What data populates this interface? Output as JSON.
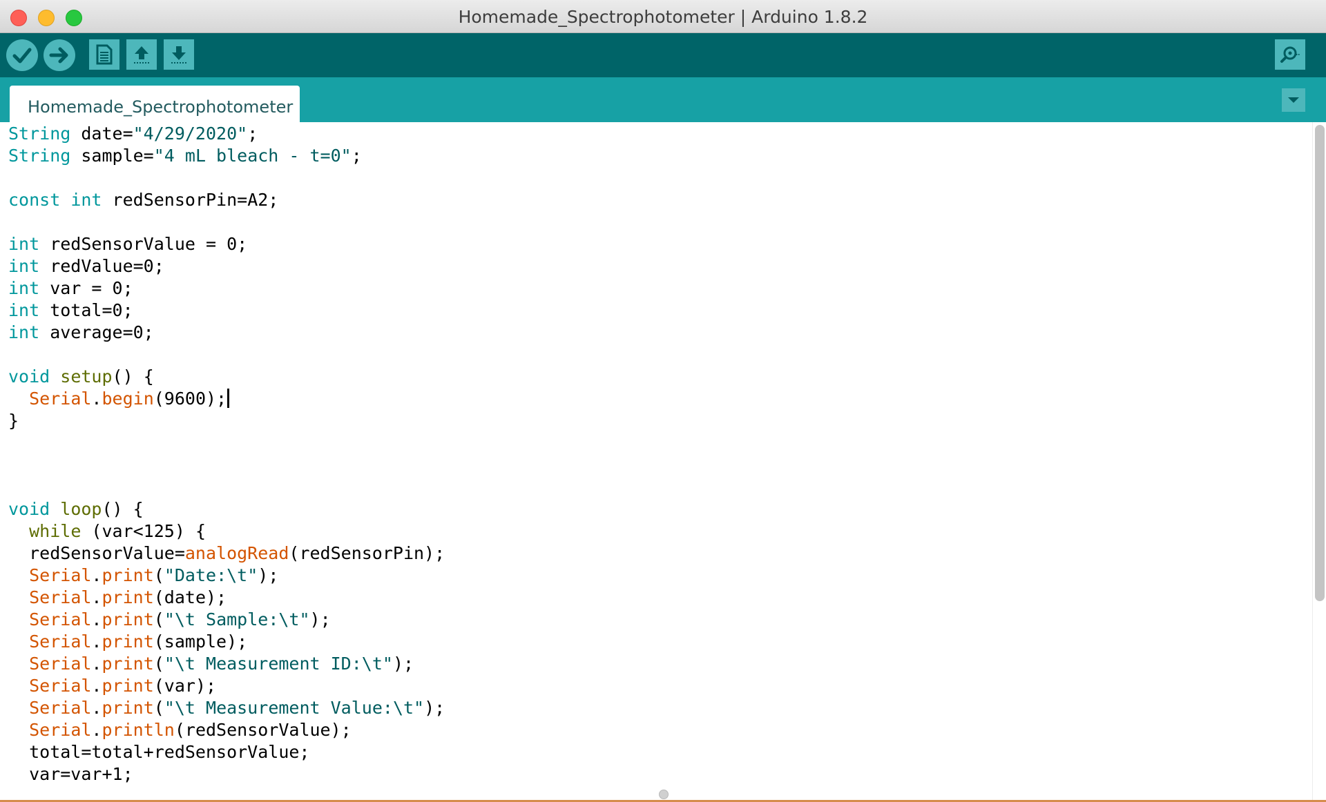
{
  "window": {
    "title": "Homemade_Spectrophotometer | Arduino 1.8.2"
  },
  "toolbar": {
    "buttons": [
      {
        "name": "verify",
        "icon": "checkmark-icon"
      },
      {
        "name": "upload",
        "icon": "arrow-right-icon"
      },
      {
        "name": "new",
        "icon": "document-icon"
      },
      {
        "name": "open",
        "icon": "arrow-up-icon"
      },
      {
        "name": "save",
        "icon": "arrow-down-icon"
      },
      {
        "name": "serial-monitor",
        "icon": "magnifier-icon"
      }
    ]
  },
  "tabs": [
    {
      "label": "Homemade_Spectrophotometer",
      "active": true
    }
  ],
  "editor": {
    "lines": [
      [
        {
          "t": "String",
          "c": "kw"
        },
        {
          "t": " date=",
          "c": ""
        },
        {
          "t": "\"4/29/2020\"",
          "c": "st"
        },
        {
          "t": ";",
          "c": ""
        }
      ],
      [
        {
          "t": "String",
          "c": "kw"
        },
        {
          "t": " sample=",
          "c": ""
        },
        {
          "t": "\"4 mL bleach - t=0\"",
          "c": "st"
        },
        {
          "t": ";",
          "c": ""
        }
      ],
      [],
      [
        {
          "t": "const",
          "c": "kw"
        },
        {
          "t": " ",
          "c": ""
        },
        {
          "t": "int",
          "c": "kw"
        },
        {
          "t": " redSensorPin=A2;",
          "c": ""
        }
      ],
      [],
      [
        {
          "t": "int",
          "c": "kw"
        },
        {
          "t": " redSensorValue = 0;",
          "c": ""
        }
      ],
      [
        {
          "t": "int",
          "c": "kw"
        },
        {
          "t": " redValue=0;",
          "c": ""
        }
      ],
      [
        {
          "t": "int",
          "c": "kw"
        },
        {
          "t": " var = 0;",
          "c": ""
        }
      ],
      [
        {
          "t": "int",
          "c": "kw"
        },
        {
          "t": " total=0;",
          "c": ""
        }
      ],
      [
        {
          "t": "int",
          "c": "kw"
        },
        {
          "t": " average=0;",
          "c": ""
        }
      ],
      [],
      [
        {
          "t": "void",
          "c": "kw"
        },
        {
          "t": " ",
          "c": ""
        },
        {
          "t": "setup",
          "c": "sf"
        },
        {
          "t": "() {",
          "c": ""
        }
      ],
      [
        {
          "t": "  ",
          "c": ""
        },
        {
          "t": "Serial",
          "c": "fn"
        },
        {
          "t": ".",
          "c": ""
        },
        {
          "t": "begin",
          "c": "fn"
        },
        {
          "t": "(9600);",
          "c": ""
        }
      ],
      [
        {
          "t": "}",
          "c": ""
        }
      ],
      [],
      [],
      [],
      [
        {
          "t": "void",
          "c": "kw"
        },
        {
          "t": " ",
          "c": ""
        },
        {
          "t": "loop",
          "c": "sf"
        },
        {
          "t": "() {",
          "c": ""
        }
      ],
      [
        {
          "t": "  ",
          "c": ""
        },
        {
          "t": "while",
          "c": "sf"
        },
        {
          "t": " (var<125) {",
          "c": ""
        }
      ],
      [
        {
          "t": "  redSensorValue=",
          "c": ""
        },
        {
          "t": "analogRead",
          "c": "fn"
        },
        {
          "t": "(redSensorPin);",
          "c": ""
        }
      ],
      [
        {
          "t": "  ",
          "c": ""
        },
        {
          "t": "Serial",
          "c": "fn"
        },
        {
          "t": ".",
          "c": ""
        },
        {
          "t": "print",
          "c": "fn"
        },
        {
          "t": "(",
          "c": ""
        },
        {
          "t": "\"Date:\\t\"",
          "c": "st"
        },
        {
          "t": ");",
          "c": ""
        }
      ],
      [
        {
          "t": "  ",
          "c": ""
        },
        {
          "t": "Serial",
          "c": "fn"
        },
        {
          "t": ".",
          "c": ""
        },
        {
          "t": "print",
          "c": "fn"
        },
        {
          "t": "(date);",
          "c": ""
        }
      ],
      [
        {
          "t": "  ",
          "c": ""
        },
        {
          "t": "Serial",
          "c": "fn"
        },
        {
          "t": ".",
          "c": ""
        },
        {
          "t": "print",
          "c": "fn"
        },
        {
          "t": "(",
          "c": ""
        },
        {
          "t": "\"\\t Sample:\\t\"",
          "c": "st"
        },
        {
          "t": ");",
          "c": ""
        }
      ],
      [
        {
          "t": "  ",
          "c": ""
        },
        {
          "t": "Serial",
          "c": "fn"
        },
        {
          "t": ".",
          "c": ""
        },
        {
          "t": "print",
          "c": "fn"
        },
        {
          "t": "(sample);",
          "c": ""
        }
      ],
      [
        {
          "t": "  ",
          "c": ""
        },
        {
          "t": "Serial",
          "c": "fn"
        },
        {
          "t": ".",
          "c": ""
        },
        {
          "t": "print",
          "c": "fn"
        },
        {
          "t": "(",
          "c": ""
        },
        {
          "t": "\"\\t Measurement ID:\\t\"",
          "c": "st"
        },
        {
          "t": ");",
          "c": ""
        }
      ],
      [
        {
          "t": "  ",
          "c": ""
        },
        {
          "t": "Serial",
          "c": "fn"
        },
        {
          "t": ".",
          "c": ""
        },
        {
          "t": "print",
          "c": "fn"
        },
        {
          "t": "(var);",
          "c": ""
        }
      ],
      [
        {
          "t": "  ",
          "c": ""
        },
        {
          "t": "Serial",
          "c": "fn"
        },
        {
          "t": ".",
          "c": ""
        },
        {
          "t": "print",
          "c": "fn"
        },
        {
          "t": "(",
          "c": ""
        },
        {
          "t": "\"\\t Measurement Value:\\t\"",
          "c": "st"
        },
        {
          "t": ");",
          "c": ""
        }
      ],
      [
        {
          "t": "  ",
          "c": ""
        },
        {
          "t": "Serial",
          "c": "fn"
        },
        {
          "t": ".",
          "c": ""
        },
        {
          "t": "println",
          "c": "fn"
        },
        {
          "t": "(redSensorValue);",
          "c": ""
        }
      ],
      [
        {
          "t": "  total=total+redSensorValue;",
          "c": ""
        }
      ],
      [
        {
          "t": "  var=var+1;",
          "c": ""
        }
      ]
    ],
    "caret_line": 12
  },
  "colors": {
    "toolbar_bg": "#006468",
    "tabsbar_bg": "#17a1a5",
    "button_bg": "#4db7bb",
    "keyword": "#00979c",
    "function": "#d35400",
    "string": "#005c5f",
    "structure": "#5e6d03"
  }
}
